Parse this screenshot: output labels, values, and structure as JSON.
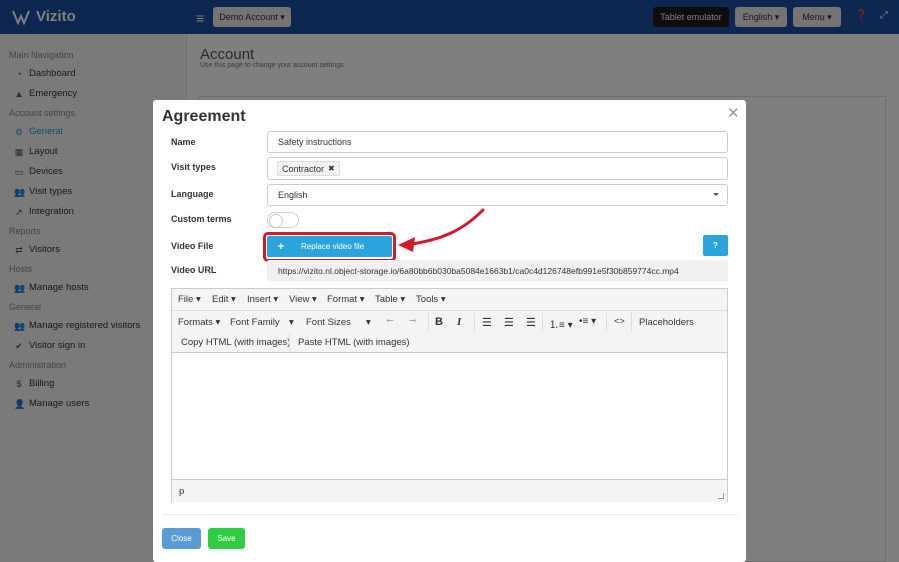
{
  "app": {
    "name": "Vizito"
  },
  "topbar": {
    "account_label": "Demo Account ▾",
    "tablet_label": "Tablet emulator",
    "language_label": "English ▾",
    "menu_label": "Menu ▾",
    "help_icon": "question-icon",
    "expand_icon": "expand-icon"
  },
  "sidebar": {
    "sections": [
      {
        "header": "Main Navigation",
        "items": [
          {
            "label": "Dashboard",
            "icon": "dashboard-icon"
          },
          {
            "label": "Emergency",
            "icon": "warning-icon"
          }
        ]
      },
      {
        "header": "Account settings",
        "items": [
          {
            "label": "General",
            "icon": "gear-icon",
            "active": true
          },
          {
            "label": "Layout",
            "icon": "layout-icon"
          },
          {
            "label": "Devices",
            "icon": "tablet-icon"
          },
          {
            "label": "Visit types",
            "icon": "users-icon"
          },
          {
            "label": "Integration",
            "icon": "rocket-icon"
          }
        ]
      },
      {
        "header": "Reports",
        "items": [
          {
            "label": "Visitors",
            "icon": "report-icon"
          }
        ]
      },
      {
        "header": "Hosts",
        "items": [
          {
            "label": "Manage hosts",
            "icon": "users-icon"
          }
        ]
      },
      {
        "header": "General",
        "items": [
          {
            "label": "Manage registered visitors",
            "icon": "users-icon"
          },
          {
            "label": "Visitor sign in",
            "icon": "sign-in-icon"
          }
        ]
      },
      {
        "header": "Administration",
        "items": [
          {
            "label": "Billing",
            "icon": "dollar-icon"
          },
          {
            "label": "Manage users",
            "icon": "user-plus-icon"
          }
        ]
      }
    ]
  },
  "main": {
    "title": "Account",
    "subtitle": "Use this page to change your account settings"
  },
  "modal": {
    "title": "Agreement",
    "fields": {
      "name_label": "Name",
      "name_value": "Safety instructions",
      "visit_types_label": "Visit types",
      "visit_type_tag": "Contractor",
      "language_label": "Language",
      "language_value": "English",
      "custom_terms_label": "Custom terms",
      "video_file_label": "Video File",
      "replace_button": "Replace video file",
      "help_button": "?",
      "video_url_label": "Video URL",
      "video_url_value": "https://vizito.nl.object-storage.io/6a80bb6b030ba5084e1663b1/ca0c4d126748efb991e5f30b859774cc.mp4"
    },
    "editor": {
      "menu": [
        "File",
        "Edit",
        "Insert",
        "View",
        "Format",
        "Table",
        "Tools"
      ],
      "formats_label": "Formats",
      "font_family_label": "Font Family",
      "font_sizes_label": "Font Sizes",
      "placeholders_label": "Placeholders",
      "copy_html_label": "Copy HTML (with images)",
      "paste_html_label": "Paste HTML (with images)",
      "status_path": "p"
    },
    "buttons": {
      "close": "Close",
      "save": "Save"
    }
  },
  "colors": {
    "topbar": "#1c4fa1",
    "accent": "#2aa4dc",
    "highlight": "#d11a2a",
    "save": "#2ecc40",
    "close": "#5b9bd5"
  }
}
